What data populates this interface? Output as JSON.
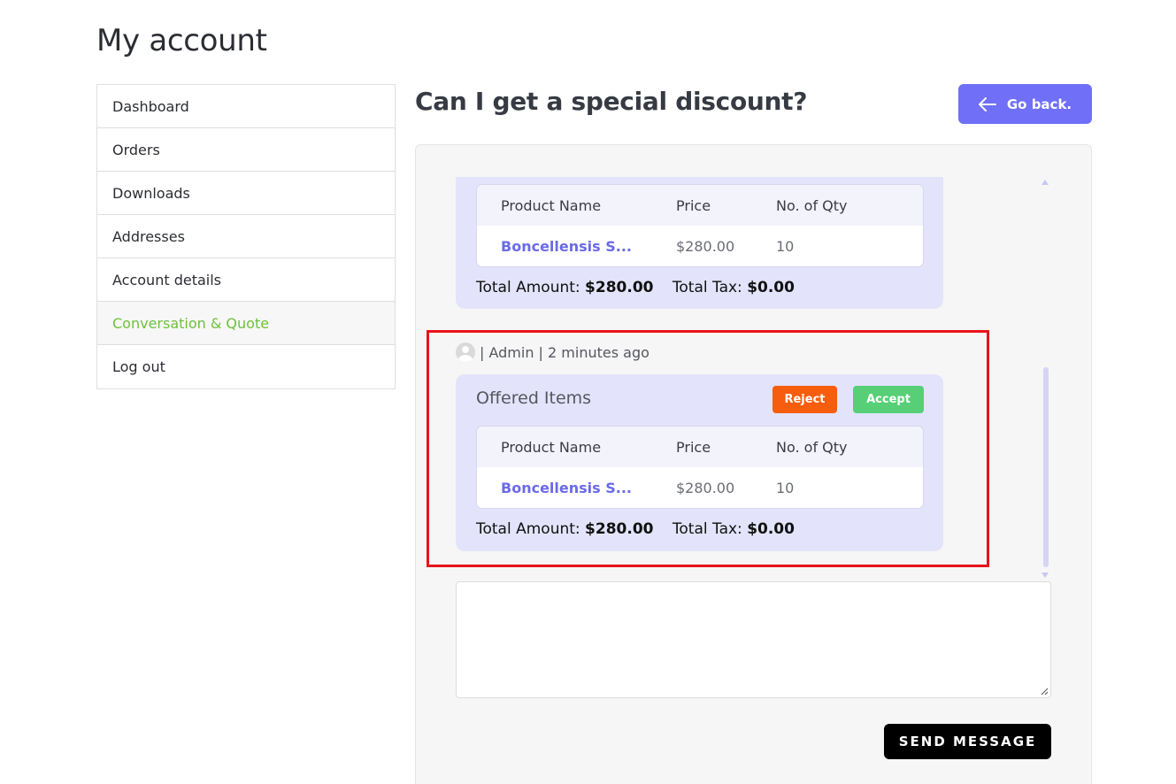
{
  "page": {
    "title": "My account"
  },
  "nav": {
    "items": [
      {
        "label": "Dashboard"
      },
      {
        "label": "Orders"
      },
      {
        "label": "Downloads"
      },
      {
        "label": "Addresses"
      },
      {
        "label": "Account details"
      },
      {
        "label": "Conversation & Quote",
        "active": true
      },
      {
        "label": "Log out"
      }
    ]
  },
  "conversation": {
    "title": "Can I get a special discount?",
    "back_label": "Go back.",
    "messages": [
      {
        "table": {
          "headers": [
            "Product Name",
            "Price",
            "No. of Qty"
          ],
          "rows": [
            {
              "name": "Boncellensis S...",
              "price": "$280.00",
              "qty": "10"
            }
          ]
        },
        "totals": {
          "amount_label": "Total Amount:",
          "amount": "$280.00",
          "tax_label": "Total Tax:",
          "tax": "$0.00"
        }
      },
      {
        "meta": "| Admin | 2 minutes ago",
        "card_title": "Offered Items",
        "reject_label": "Reject",
        "accept_label": "Accept",
        "table": {
          "headers": [
            "Product Name",
            "Price",
            "No. of Qty"
          ],
          "rows": [
            {
              "name": "Boncellensis S...",
              "price": "$280.00",
              "qty": "10"
            }
          ]
        },
        "totals": {
          "amount_label": "Total Amount:",
          "amount": "$280.00",
          "tax_label": "Total Tax:",
          "tax": "$0.00"
        }
      }
    ],
    "message_input": {
      "value": "",
      "placeholder": ""
    },
    "send_label": "SEND MESSAGE"
  },
  "colors": {
    "accent": "#6f6ff7",
    "active_nav": "#6ec13a",
    "reject": "#f65d0d",
    "accept": "#56cf76",
    "card_bg": "#e3e3fb",
    "highlight": "#e8131a"
  },
  "icons": {
    "back": "arrow-left-icon",
    "avatar": "user-avatar-icon"
  }
}
